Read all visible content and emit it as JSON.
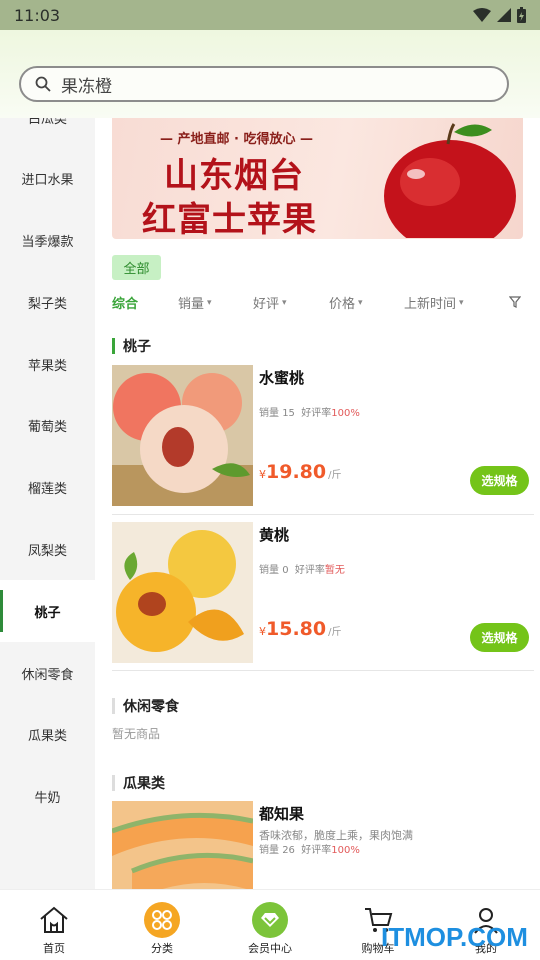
{
  "status_bar": {
    "time": "11:03"
  },
  "search": {
    "value": "果冻橙"
  },
  "sidebar": {
    "items": [
      {
        "label": "白瓜类"
      },
      {
        "label": "进口水果"
      },
      {
        "label": "当季爆款"
      },
      {
        "label": "梨子类"
      },
      {
        "label": "苹果类"
      },
      {
        "label": "葡萄类"
      },
      {
        "label": "榴莲类"
      },
      {
        "label": "凤梨类"
      },
      {
        "label": "桃子"
      },
      {
        "label": "休闲零食"
      },
      {
        "label": "瓜果类"
      },
      {
        "label": "牛奶"
      }
    ],
    "active_index": 8
  },
  "banner": {
    "subtitle": "— 产地直邮 · 吃得放心 —",
    "title_line1": "山东烟台",
    "title_line2": "红富士苹果"
  },
  "filter_chip": {
    "label": "全部"
  },
  "sort_bar": {
    "items": [
      "综合",
      "销量",
      "好评",
      "价格",
      "上新时间"
    ],
    "active_index": 0
  },
  "sections": [
    {
      "title": "桃子",
      "products": [
        {
          "name": "水蜜桃",
          "sales_label": "销量",
          "sales": "15",
          "rating_label": "好评率",
          "rating": "100%",
          "currency": "¥",
          "price": "19.80",
          "unit": "/斤",
          "button": "选规格"
        },
        {
          "name": "黄桃",
          "sales_label": "销量",
          "sales": "0",
          "rating_label": "好评率",
          "rating": "暂无",
          "currency": "¥",
          "price": "15.80",
          "unit": "/斤",
          "button": "选规格"
        }
      ]
    },
    {
      "title": "休闲零食",
      "empty_text": "暂无商品"
    },
    {
      "title": "瓜果类",
      "products": [
        {
          "name": "都知果",
          "desc": "香味浓郁，脆度上乘，果肉饱满",
          "sales_label": "销量",
          "sales": "26",
          "rating_label": "好评率",
          "rating": "100%"
        }
      ]
    }
  ],
  "bottom_nav": {
    "items": [
      {
        "label": "首页",
        "icon": "home-icon"
      },
      {
        "label": "分类",
        "icon": "category-icon"
      },
      {
        "label": "会员中心",
        "icon": "member-icon"
      },
      {
        "label": "购物车",
        "icon": "cart-icon"
      },
      {
        "label": "我的",
        "icon": "user-icon"
      }
    ],
    "active_index": 1
  },
  "watermark": "ITMOP.COM",
  "colors": {
    "accent_green": "#74c419",
    "price_orange": "#f05a2a",
    "banner_red": "#b3121a",
    "status_bar": "#a4b58d"
  }
}
